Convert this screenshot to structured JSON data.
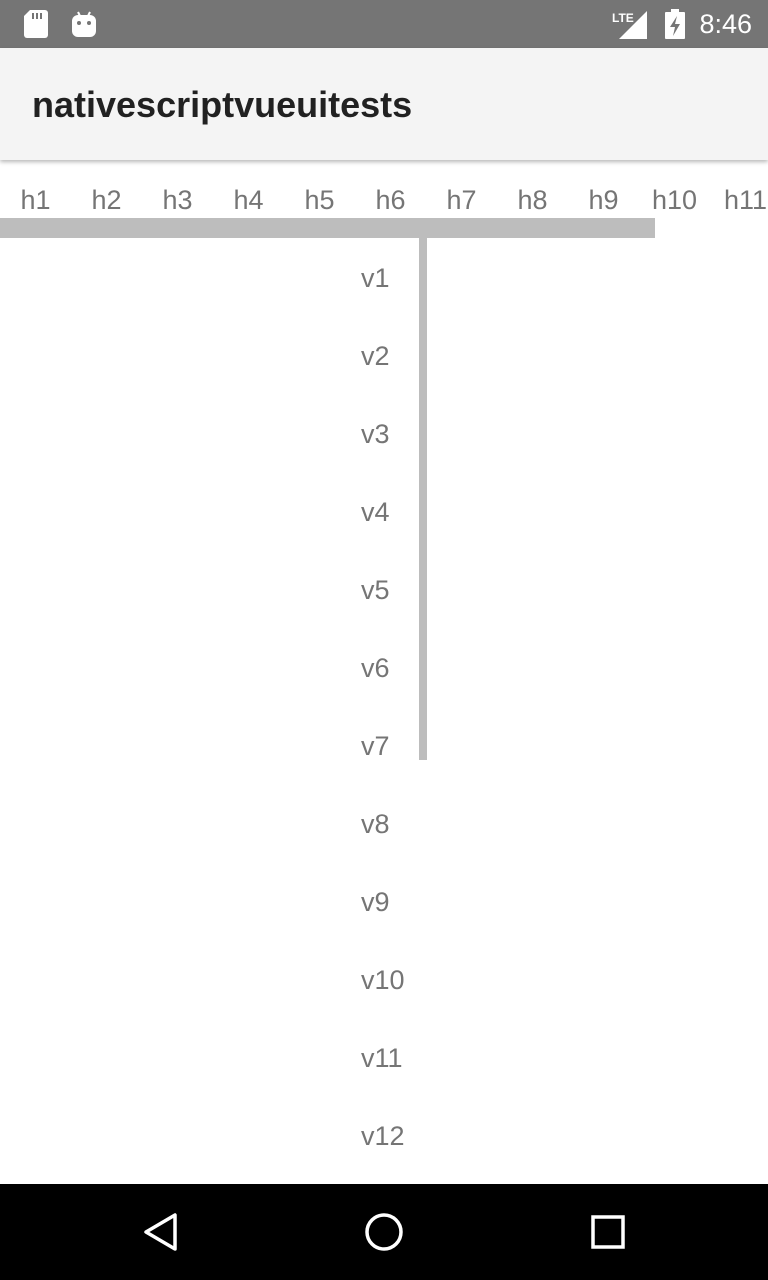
{
  "status_bar": {
    "time": "8:46",
    "network": "LTE",
    "icons": [
      "sd-card-icon",
      "android-icon",
      "lte-signal-icon",
      "battery-charging-icon"
    ]
  },
  "app_bar": {
    "title": "nativescriptvueuitests"
  },
  "horizontal_list": {
    "items": [
      "h1",
      "h2",
      "h3",
      "h4",
      "h5",
      "h6",
      "h7",
      "h8",
      "h9",
      "h10",
      "h11"
    ]
  },
  "vertical_list": {
    "items": [
      "v1",
      "v2",
      "v3",
      "v4",
      "v5",
      "v6",
      "v7",
      "v8",
      "v9",
      "v10",
      "v11",
      "v12"
    ]
  },
  "nav_bar": {
    "buttons": [
      "back-icon",
      "home-icon",
      "recents-icon"
    ]
  },
  "colors": {
    "status_bar": "#757575",
    "app_bar": "#f4f4f4",
    "text": "#757575",
    "scrollbar": "#bdbdbd",
    "nav_bar": "#000000"
  }
}
